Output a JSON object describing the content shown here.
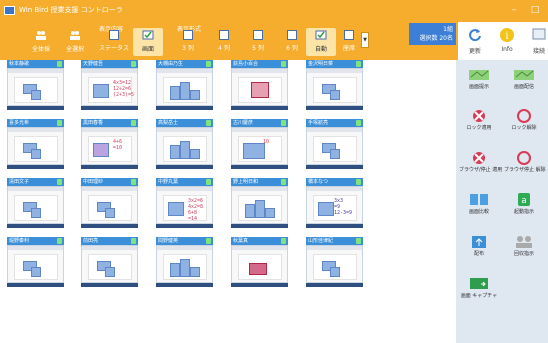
{
  "window": {
    "title": "Win Bird 授業支援 コントローラ",
    "controls": {
      "minimize": "–",
      "maximize": "□"
    }
  },
  "toolbar": {
    "group_display_content": "表示内容",
    "group_display_format": "表示形式",
    "buttons": [
      {
        "label": "全体採",
        "icon": "students-group-icon"
      },
      {
        "label": "全選択",
        "icon": "students-select-icon"
      },
      {
        "label": "ステータス",
        "icon": "square-icon"
      },
      {
        "label": "画面",
        "icon": "check-screen-icon",
        "pressed": true
      },
      {
        "label": "3 列",
        "icon": "square-icon"
      },
      {
        "label": "4 列",
        "icon": "square-icon"
      },
      {
        "label": "5 列",
        "icon": "square-icon"
      },
      {
        "label": "6 列",
        "icon": "square-icon"
      },
      {
        "label": "自動",
        "icon": "check-auto-icon",
        "pressed": true
      },
      {
        "label": "座席",
        "icon": "square-icon"
      }
    ],
    "status": {
      "line1": "1組",
      "line2": "選択数 20名"
    },
    "right_buttons": [
      {
        "label": "更新",
        "icon": "refresh-icon"
      },
      {
        "label": "Info",
        "icon": "info-icon"
      },
      {
        "label": "接続",
        "icon": "connect-icon"
      }
    ]
  },
  "students": [
    {
      "name": "秋本静歌",
      "thumb": "plain"
    },
    {
      "name": "天野健吾",
      "thumb": "ink",
      "ink": [
        "4x3=12",
        "12÷2=6",
        "(2+3)=5"
      ]
    },
    {
      "name": "大槻由乃生",
      "thumb": "steps"
    },
    {
      "name": "荻島小百合",
      "thumb": "red-box"
    },
    {
      "name": "金沢明日菜",
      "thumb": "plain"
    },
    {
      "name": "喜多光希",
      "thumb": "plain"
    },
    {
      "name": "黒田春香",
      "thumb": "ink-purple",
      "ink": [
        "4+6",
        "=10"
      ]
    },
    {
      "name": "高梨岳士",
      "thumb": "steps"
    },
    {
      "name": "古川慶彦",
      "thumb": "grid-ink",
      "ink": [
        "10"
      ]
    },
    {
      "name": "手塚航亮",
      "thumb": "plain"
    },
    {
      "name": "清田文子",
      "thumb": "plain"
    },
    {
      "name": "中田理紗",
      "thumb": "plain"
    },
    {
      "name": "中野丸葉",
      "thumb": "ink",
      "ink": [
        "3x2=6",
        "4x2=8",
        "6+8",
        "=14"
      ]
    },
    {
      "name": "野上明日和",
      "thumb": "steps"
    },
    {
      "name": "橋本なつ",
      "thumb": "ink-text",
      "ink": [
        "3x3",
        "=9",
        "12-3=9"
      ]
    },
    {
      "name": "堀野秦利",
      "thumb": "plain"
    },
    {
      "name": "前田亮",
      "thumb": "plain"
    },
    {
      "name": "間野健英",
      "thumb": "steps"
    },
    {
      "name": "秋葉真",
      "thumb": "red-shape"
    },
    {
      "name": "山形佳津紀",
      "thumb": "plain"
    }
  ],
  "panel": {
    "buttons": [
      {
        "label": "画面提示",
        "icon": "screen-present-icon"
      },
      {
        "label": "画面配信",
        "icon": "screen-distribute-icon"
      },
      {
        "label": "ロック適用",
        "icon": "lock-apply-icon"
      },
      {
        "label": "ロック解除",
        "icon": "lock-release-icon"
      },
      {
        "label": "ブラウザ/停止 適用",
        "icon": "browser-block-apply-icon"
      },
      {
        "label": "ブラウザ停止 解除",
        "icon": "browser-block-release-icon"
      },
      {
        "label": "画面比較",
        "icon": "screen-compare-icon"
      },
      {
        "label": "起動指示",
        "icon": "launch-icon"
      },
      {
        "label": "配布",
        "icon": "distribute-icon"
      },
      {
        "label": "回収指示",
        "icon": "collect-icon"
      },
      {
        "label": "画面 キャプチャ",
        "icon": "screen-capture-icon"
      }
    ]
  },
  "colors": {
    "titlebar": "#f6ad2d",
    "tile_header": "#3b8fd9",
    "panel_bg": "#dfe7f1",
    "status_box": "#3d7fd6"
  }
}
